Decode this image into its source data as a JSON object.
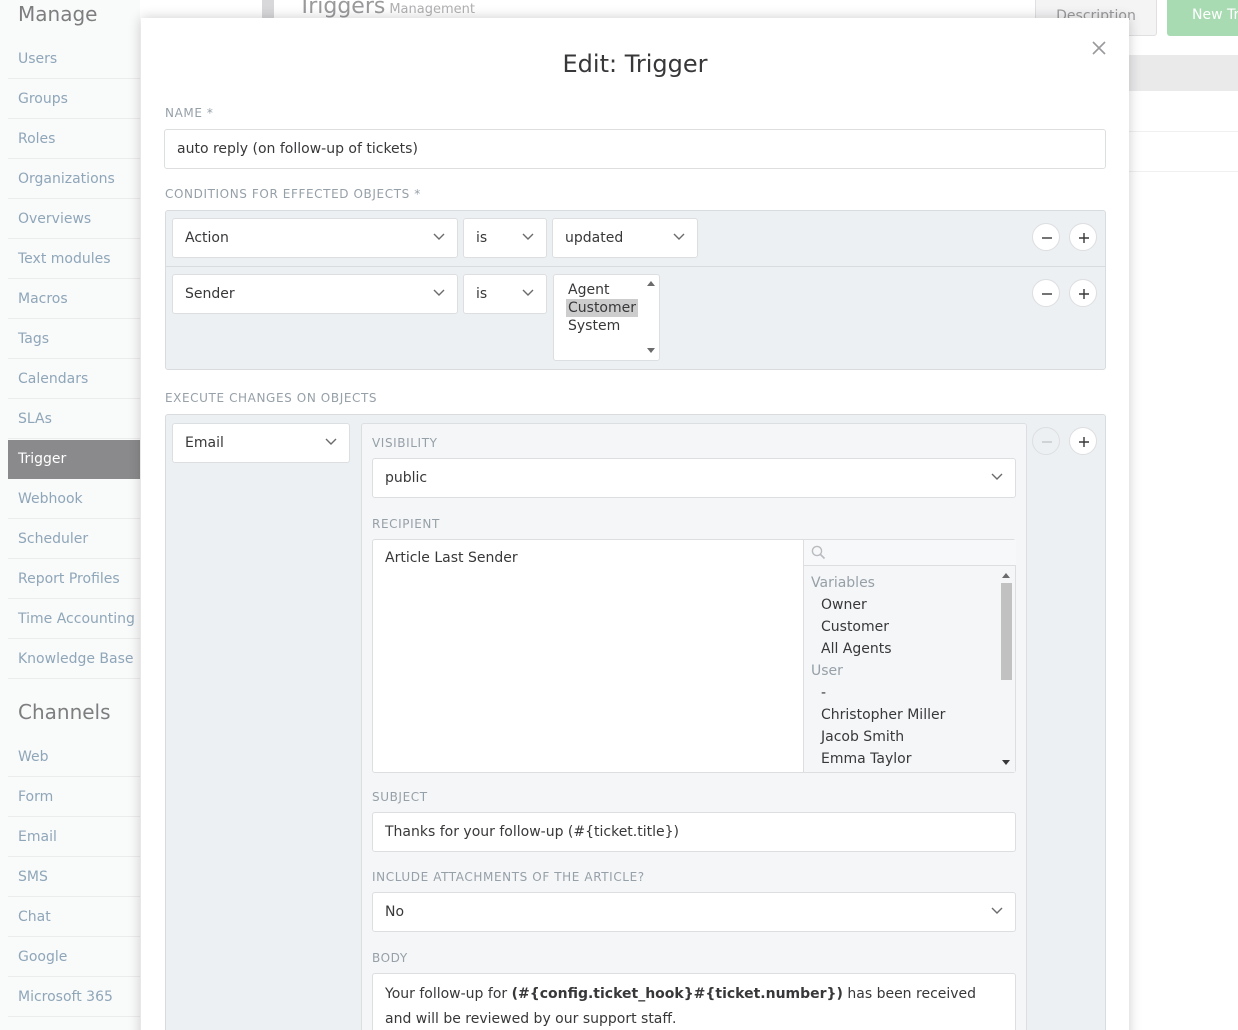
{
  "sidebar": {
    "manage_heading": "Manage",
    "manage_items": [
      "Users",
      "Groups",
      "Roles",
      "Organizations",
      "Overviews",
      "Text modules",
      "Macros",
      "Tags",
      "Calendars",
      "SLAs",
      "Trigger",
      "Webhook",
      "Scheduler",
      "Report Profiles",
      "Time Accounting",
      "Knowledge Base"
    ],
    "active_item": "Trigger",
    "channels_heading": "Channels",
    "channel_items": [
      "Web",
      "Form",
      "Email",
      "SMS",
      "Chat",
      "Google",
      "Microsoft 365"
    ]
  },
  "background": {
    "title": "Triggers",
    "subtitle": "Management",
    "description_button": "Description",
    "new_button": "New Tri"
  },
  "modal": {
    "title": "Edit: Trigger",
    "name_label": "NAME *",
    "name_value": "auto reply (on follow-up of tickets)",
    "conditions_label": "CONDITIONS FOR EFFECTED OBJECTS *",
    "conditions": [
      {
        "attribute": "Action",
        "operator": "is",
        "value": "updated"
      },
      {
        "attribute": "Sender",
        "operator": "is",
        "options": [
          "Agent",
          "Customer",
          "System"
        ],
        "selected": "Customer"
      }
    ],
    "execute_label": "EXECUTE CHANGES ON OBJECTS",
    "execute_type": "Email",
    "visibility_label": "VISIBILITY",
    "visibility_value": "public",
    "recipient_label": "RECIPIENT",
    "recipient_token": "Article Last Sender",
    "recipient_groups": [
      {
        "heading": "Variables",
        "items": [
          "Owner",
          "Customer",
          "All Agents"
        ]
      },
      {
        "heading": "User",
        "items": [
          "-",
          "Christopher Miller",
          "Jacob Smith",
          "Emma Taylor"
        ]
      }
    ],
    "subject_label": "SUBJECT",
    "subject_value": "Thanks for your follow-up (#{ticket.title})",
    "attachments_label": "INCLUDE ATTACHMENTS OF THE ARTICLE?",
    "attachments_value": "No",
    "body_label": "BODY",
    "body_prefix": "Your follow-up for ",
    "body_bold": "(#{config.ticket_hook}#{ticket.number})",
    "body_suffix": " has been received and will be reviewed by our support staff."
  },
  "colors": {
    "sidebar_link": "#8fa6b9",
    "active_bg": "#8a8a8c",
    "label": "#96a0a8",
    "condition_bg": "#edf0f3",
    "new_button_bg": "#a9dbb2"
  }
}
